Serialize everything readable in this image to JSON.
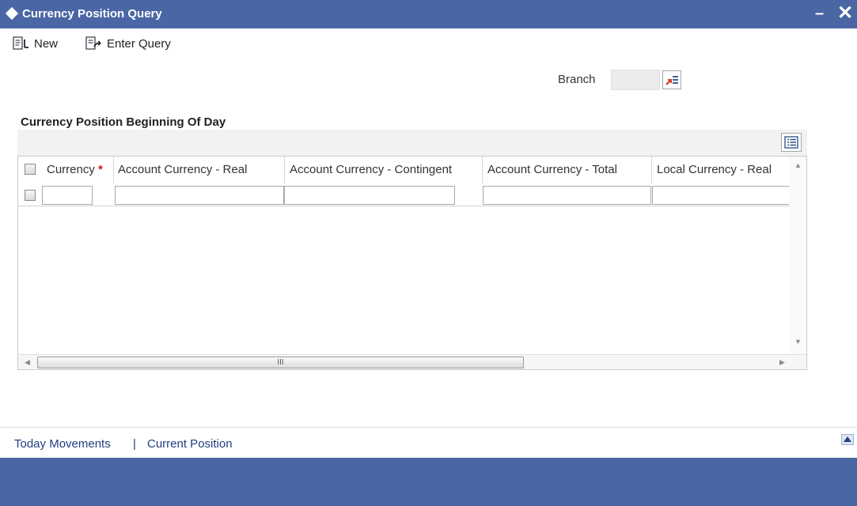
{
  "window": {
    "title": "Currency Position Query",
    "minimize_symbol": "–",
    "close_symbol": "✕"
  },
  "toolbar": {
    "new_label": "New",
    "enter_query_label": "Enter Query"
  },
  "branch": {
    "label": "Branch",
    "value": ""
  },
  "section": {
    "title": "Currency Position Beginning Of Day"
  },
  "grid": {
    "columns": [
      {
        "label": "Currency",
        "required": true
      },
      {
        "label": "Account Currency - Real"
      },
      {
        "label": "Account Currency - Contingent"
      },
      {
        "label": "Account Currency - Total"
      },
      {
        "label": "Local Currency - Real"
      }
    ],
    "required_marker": "*",
    "hscroll_grip": "III"
  },
  "footer": {
    "links": [
      "Today Movements",
      "Current Position"
    ],
    "separator": "|"
  },
  "colors": {
    "title_bar": "#4a66a5",
    "link": "#1f3f82",
    "required": "#d11111"
  }
}
